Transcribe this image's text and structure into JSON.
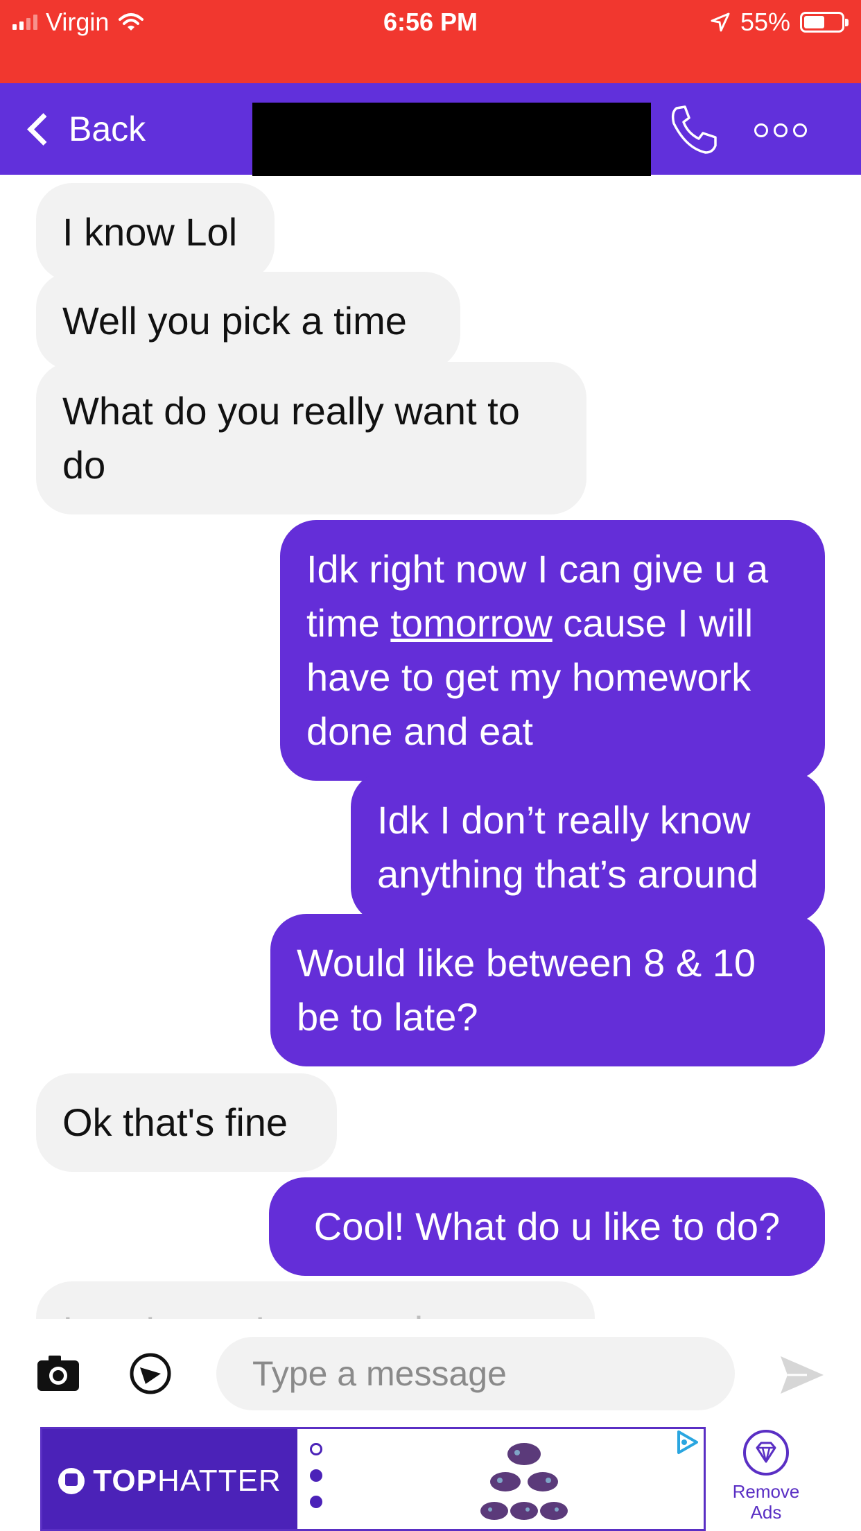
{
  "status_bar": {
    "carrier": "Virgin",
    "time": "6:56 PM",
    "battery_percent": "55%",
    "battery_level": 0.55,
    "signal_bars": 2,
    "icons": [
      "signal-icon",
      "wifi-icon",
      "location-arrow-icon",
      "battery-icon"
    ],
    "color": "#f1372f"
  },
  "nav": {
    "back_label": "Back",
    "title_redacted": true,
    "icons": [
      "back-chevron-icon",
      "phone-icon",
      "more-dots-icon"
    ],
    "color": "#6130db"
  },
  "messages": [
    {
      "direction": "incoming",
      "text": "I know Lol"
    },
    {
      "direction": "incoming",
      "text": "Well you pick a time"
    },
    {
      "direction": "incoming",
      "text": "What do you really want to do"
    },
    {
      "direction": "outgoing",
      "text_before": "Idk right now I can give u a time ",
      "text_link": "tomorrow",
      "text_after": " cause I will have to get my homework done and eat"
    },
    {
      "direction": "outgoing",
      "text": "Idk I don’t really know anything that’s around"
    },
    {
      "direction": "outgoing",
      "text": "Would like between 8 & 10 be to late?"
    },
    {
      "direction": "incoming",
      "text": "Ok that's fine"
    },
    {
      "direction": "outgoing",
      "text": "Cool! What do u like to do?"
    },
    {
      "direction": "incoming",
      "text": "I can't say. I can get in"
    }
  ],
  "composer": {
    "placeholder": "Type a message",
    "icons": [
      "camera-icon",
      "sticker-icon",
      "send-icon"
    ]
  },
  "ad": {
    "brand": "TOPHATTER",
    "brand_bold_part": "TOP",
    "brand_rest": "HATTER",
    "remove_ads_line1": "Remove",
    "remove_ads_line2": "Ads",
    "icons": [
      "tophatter-logo-icon",
      "ad-choices-icon",
      "diamond-icon",
      "controller-product-image"
    ]
  },
  "colors": {
    "outgoing_bubble": "#642ed8",
    "incoming_bubble": "#f2f2f2",
    "accent": "#5a2fc4"
  }
}
